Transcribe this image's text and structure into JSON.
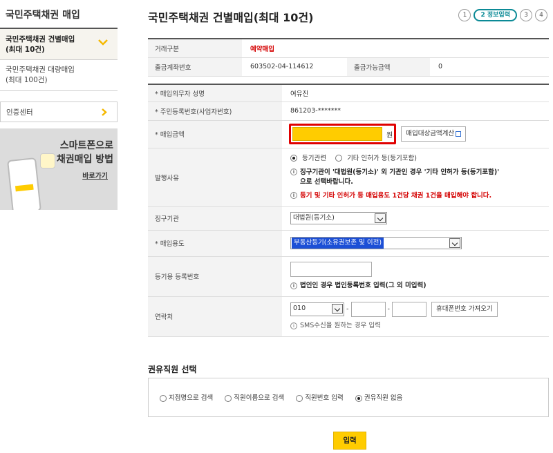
{
  "sidebar": {
    "title": "국민주택채권 매입",
    "items": [
      {
        "label_line1": "국민주택채권 건별매입",
        "label_line2": "(최대 10건)"
      },
      {
        "label_line1": "국민주택채권 대량매입",
        "label_line2": "(최대 100건)"
      }
    ],
    "cert": "인증센터",
    "banner": {
      "line1": "스마트폰으로",
      "line2": "채권매입 방법",
      "link": "바로가기"
    }
  },
  "header": {
    "title": "국민주택채권 건별매입(최대 10건)",
    "steps": [
      "1",
      "2 정보입력",
      "3",
      "4"
    ]
  },
  "top_table": {
    "trade_type_label": "거래구분",
    "trade_type_value": "예약매입",
    "account_label": "출금계좌번호",
    "account_value": "603502-04-114612",
    "avail_label": "출금가능금액",
    "avail_value": "0"
  },
  "form": {
    "name_label": "* 매입의무자 성명",
    "name_value": "여유진",
    "rrn_label": "* 주민등록번호(사업자번호)",
    "rrn_value": "861203-*******",
    "amount_label": "* 매입금액",
    "amount_unit": "원",
    "amount_calc_button": "매입대상금액계산",
    "reason_label": "발행사유",
    "reason_opt1": "등기관련",
    "reason_opt2": "기타 인허가 등(등기포함)",
    "reason_note1_l1": "징구기관이 '대법원(등기소)' 외 기관인 경우 '기타 인허가 등(등기포함)'",
    "reason_note1_l2": "으로 선택바랍니다.",
    "reason_note2": "등기 및 기타 인허가 등 매입용도 1건당 채권 1건을 매입해야 합니다.",
    "agency_label": "징구기관",
    "agency_value": "대법원(등기소)",
    "purpose_label": "* 매입용도",
    "purpose_value": "부동산등기(소유권보존 및 이전)",
    "regno_label": "등기용 등록번호",
    "regno_note": "법인인 경우 법인등록번호 입력(그 외 미입력)",
    "contact_label": "연락처",
    "phone_prefix": "010",
    "phone_sep": "-",
    "phone_fetch_button": "휴대폰번호 가져오기",
    "contact_note": "SMS수신을 원하는 경우 입력"
  },
  "staff": {
    "title": "권유직원 선택",
    "options": [
      "지점명으로 검색",
      "직원이름으로 검색",
      "직원번호 입력",
      "권유직원 없음"
    ],
    "selected_index": 3
  },
  "submit_label": "입력",
  "colors": {
    "accent_yellow": "#ffcc00",
    "highlight_red": "#e00000",
    "step_teal": "#0b8a96",
    "select_blue": "#1c4fd6"
  }
}
